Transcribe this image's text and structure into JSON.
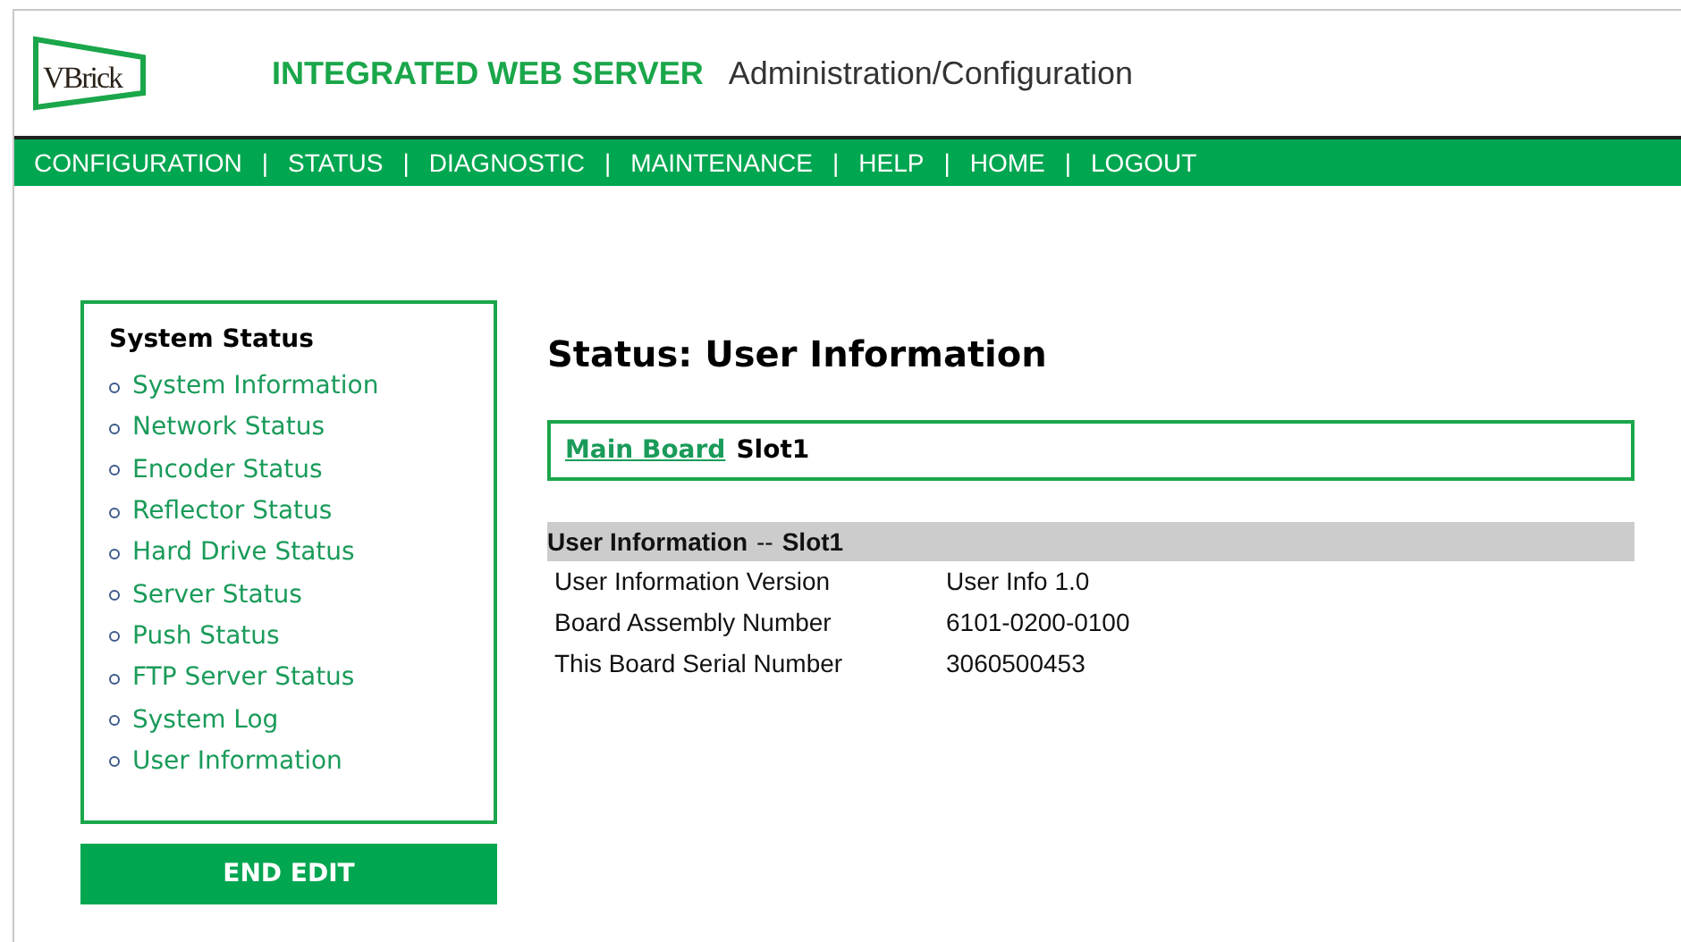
{
  "header": {
    "logo": "VBrick",
    "title": "INTEGRATED WEB SERVER",
    "subtitle": "Administration/Configuration"
  },
  "nav": [
    {
      "kind": "link",
      "label": "CONFIGURATION"
    },
    {
      "kind": "separator",
      "label": "|"
    },
    {
      "kind": "link",
      "label": "STATUS"
    },
    {
      "kind": "separator",
      "label": "|"
    },
    {
      "kind": "link",
      "label": "DIAGNOSTIC"
    },
    {
      "kind": "separator",
      "label": "|"
    },
    {
      "kind": "link",
      "label": "MAINTENANCE"
    },
    {
      "kind": "separator",
      "label": "|"
    },
    {
      "kind": "link",
      "label": "HELP"
    },
    {
      "kind": "separator",
      "label": "|"
    },
    {
      "kind": "link",
      "label": "HOME"
    },
    {
      "kind": "separator",
      "label": "|"
    },
    {
      "kind": "link",
      "label": "LOGOUT"
    }
  ],
  "sidebar": {
    "title": "System Status",
    "items": [
      "System Information",
      "Network Status",
      "Encoder Status",
      "Reflector Status",
      "Hard Drive Status",
      "Server Status",
      "Push Status",
      "FTP Server Status",
      "System Log",
      "User Information"
    ],
    "button": "END EDIT"
  },
  "main": {
    "title": "Status: User Information",
    "board_link": "Main Board",
    "board_slot": "Slot1",
    "section": {
      "title": "User Information",
      "separator": "--",
      "slot": "Slot1"
    },
    "rows": [
      {
        "label": "User Information Version",
        "value": "User Info 1.0"
      },
      {
        "label": "Board Assembly Number",
        "value": "6101-0200-0100"
      },
      {
        "label": "This Board Serial Number",
        "value": "3060500453"
      }
    ]
  }
}
